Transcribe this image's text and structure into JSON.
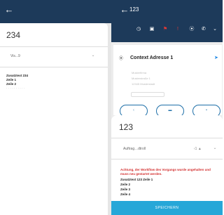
{
  "left": {
    "back_icon": "arrow-left-icon",
    "title": "234",
    "select_value": "Vis...9",
    "info_lines": [
      "Zusatztext 234",
      "Zeile 1",
      "Zeile 2",
      "· · · · · · · · · ·"
    ]
  },
  "right": {
    "back_icon": "arrow-left-icon",
    "bar_title": "123",
    "context_title": "Context Adresse 1",
    "address_lines": [
      "Musterfirma",
      "Musterstraße 1",
      "12345 Musterstadt"
    ],
    "chip_text": "",
    "round_buttons": [
      "‹",
      "▬",
      "•"
    ],
    "sheet_title": "123",
    "select_value": "Auftrag…dtroll",
    "select_extra": "‹1 ▲",
    "warning": "Achtung, der Workflow des Vorgangs wurde angehalten und muss neu gestartet werden.",
    "lines": [
      "Zusatztext 123 Zeile 1",
      "Zeile 2",
      "Zeile 3",
      "Zeile 4"
    ],
    "save_label": "SPEICHERN"
  },
  "colors": {
    "appbar": "#1d3a5a",
    "accent": "#26a7d8",
    "warning": "#d32f2f",
    "nav": "#1e88e5"
  }
}
